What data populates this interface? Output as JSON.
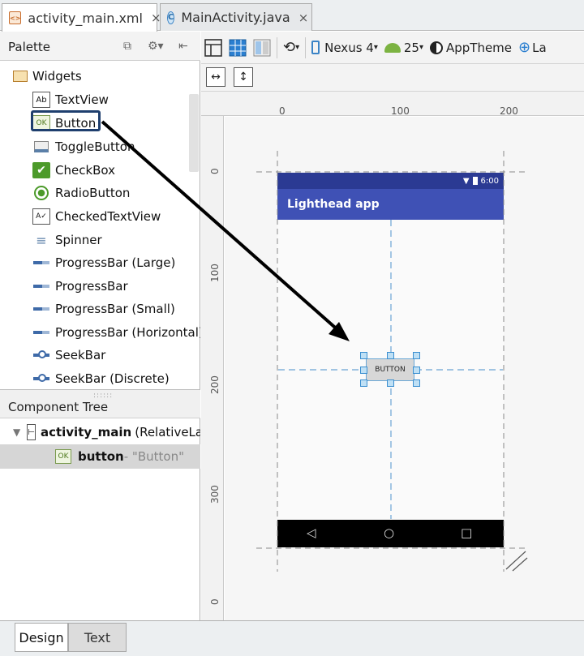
{
  "editor_tabs": [
    {
      "label": "activity_main.xml",
      "icon": "xml-file-icon",
      "active": true
    },
    {
      "label": "MainActivity.java",
      "icon": "java-class-icon",
      "active": false
    }
  ],
  "tab_close_glyph": "×",
  "java_icon_letter": "C",
  "xml_icon_letters": "<>",
  "palette": {
    "title": "Palette",
    "group": "Widgets",
    "items": [
      {
        "label": "TextView",
        "icon": "Ab"
      },
      {
        "label": "Button",
        "icon": "OK"
      },
      {
        "label": "ToggleButton",
        "icon": ""
      },
      {
        "label": "CheckBox",
        "icon": "✔"
      },
      {
        "label": "RadioButton",
        "icon": "●"
      },
      {
        "label": "CheckedTextView",
        "icon": "A✓"
      },
      {
        "label": "Spinner",
        "icon": "≡"
      },
      {
        "label": "ProgressBar (Large)",
        "icon": ""
      },
      {
        "label": "ProgressBar",
        "icon": ""
      },
      {
        "label": "ProgressBar (Small)",
        "icon": ""
      },
      {
        "label": "ProgressBar (Horizontal)",
        "icon": ""
      },
      {
        "label": "SeekBar",
        "icon": ""
      },
      {
        "label": "SeekBar (Discrete)",
        "icon": ""
      }
    ]
  },
  "component_tree": {
    "title": "Component Tree",
    "root": {
      "name": "activity_main",
      "type": "(RelativeLa"
    },
    "child": {
      "name": "button",
      "detail": " - \"Button\"",
      "icon": "OK"
    }
  },
  "toolbar": {
    "device": "Nexus 4",
    "api": "25",
    "theme": "AppTheme",
    "locale": "La"
  },
  "rulers": {
    "horizontal": [
      "0",
      "100",
      "200"
    ],
    "vertical": [
      "0",
      "100",
      "200",
      "300",
      "0"
    ]
  },
  "device_screen": {
    "time": "6:00",
    "app_title": "Lighthead app",
    "button_label": "BUTTON",
    "status_color": "#2b3a93",
    "appbar_color": "#3f51b5"
  },
  "bottom_tabs": [
    {
      "label": "Design",
      "active": true
    },
    {
      "label": "Text",
      "active": false
    }
  ]
}
